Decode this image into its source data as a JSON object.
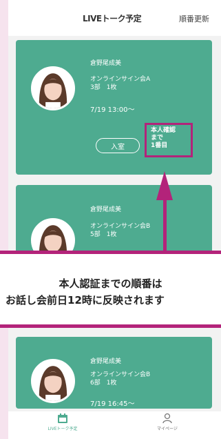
{
  "header": {
    "title": "LIVEトーク予定",
    "action": "順番更新"
  },
  "cards": [
    {
      "name": "倉野尾成美",
      "event": "オンラインサイン会A",
      "detail": "3部　1枚",
      "time": "7/19 13:00〜",
      "button": "入室",
      "status": [
        "本人確認",
        "まで",
        "1番目"
      ]
    },
    {
      "name": "倉野尾成美",
      "event": "オンラインサイン会B",
      "detail": "5部　1枚"
    },
    {
      "name": "倉野尾成美",
      "event": "オンラインサイン会B",
      "detail": "6部　1枚",
      "time": "7/19 16:45〜"
    }
  ],
  "notice": {
    "line1": "本人認証までの順番は",
    "line2": "お話し会前日12時に反映されます"
  },
  "tabbar": {
    "tab1_label": "LIVEトーク予定",
    "tab2_label": "マイページ"
  },
  "colors": {
    "card_green": "#4eab90",
    "accent_magenta": "#b3237a",
    "background_pink": "#f6e3ee"
  },
  "icons": {
    "tab1": "calendar-icon",
    "tab2": "person-icon"
  }
}
